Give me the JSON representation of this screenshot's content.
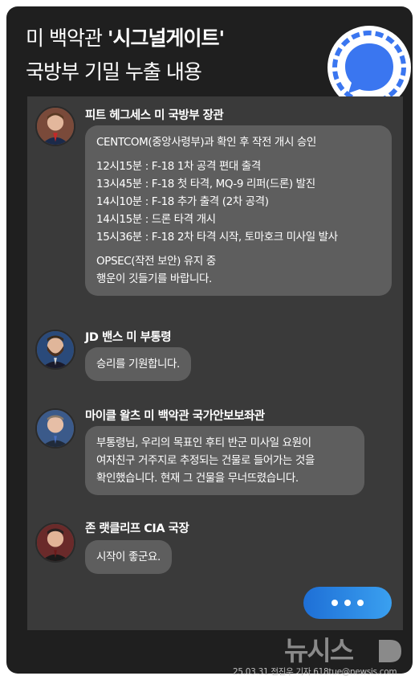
{
  "header": {
    "title_prefix": "미 백악관 ",
    "title_highlight": "'시그널게이트'",
    "title_line2": "국방부 기밀 누출 내용"
  },
  "messages": [
    {
      "sender": "피트 헤그세스 미 국방부 장관",
      "lines": [
        "CENTCOM(중앙사령부)과 확인 후 작전 개시 승인",
        "",
        "12시15분 : F-18 1차 공격 편대 출격",
        "13시45분 : F-18 첫 타격, MQ-9 리퍼(드론) 발진",
        "14시10분 : F-18 추가 출격 (2차 공격)",
        "14시15분 : 드론 타격 개시",
        "15시36분 : F-18 2차 타격 시작, 토마호크 미사일 발사",
        "",
        "OPSEC(작전 보안) 유지 중",
        "행운이 깃들기를 바랍니다."
      ]
    },
    {
      "sender": "JD 밴스 미 부통령",
      "lines": [
        "승리를 기원합니다."
      ]
    },
    {
      "sender": "마이클 왈츠 미 백악관 국가안보보좌관",
      "lines": [
        "부통령님, 우리의 목표인 후티 반군 미사일 요원이",
        "여자친구 거주지로 추정되는 건물로 들어가는 것을",
        "확인했습니다. 현재 그 건물을 무너뜨렸습니다."
      ]
    },
    {
      "sender": "존 랫클리프 CIA 국장",
      "lines": [
        "시작이 좋군요."
      ]
    }
  ],
  "typing_indicator": "•••",
  "brand": "뉴시스",
  "credit": "25.03.31  전진우 기자  618tue@newsis.com",
  "colors": {
    "frame": "#1f1f1f",
    "chat_background": "#3a3a3a",
    "bubble": "#5e5e5e",
    "signal_blue": "#3a76f0",
    "typing_gradient_start": "#1e6fd6",
    "typing_gradient_end": "#3aa0f0"
  },
  "icons": {
    "app_logo": "signal-logo-icon",
    "typing": "typing-dots-icon"
  }
}
